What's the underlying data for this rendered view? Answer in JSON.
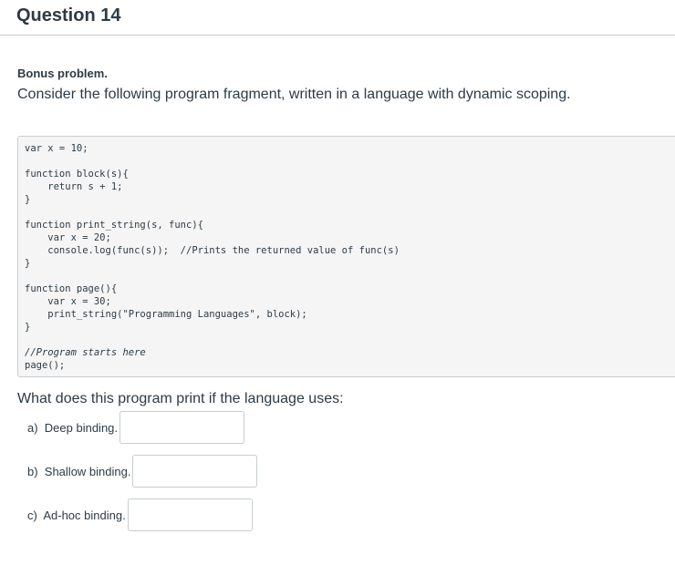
{
  "question": {
    "title": "Question 14",
    "bonus": "Bonus problem.",
    "intro": "Consider the following program fragment, written in a language with dynamic scoping.",
    "code_lines": [
      "var x = 10;",
      "",
      "function block(s){",
      "    return s + 1;",
      "}",
      "",
      "function print_string(s, func){",
      "    var x = 20;",
      "    console.log(func(s));  //Prints the returned value of func(s)",
      "}",
      "",
      "function page(){",
      "    var x = 30;",
      "    print_string(\"Programming Languages\", block);",
      "}",
      "",
      "//Program starts here",
      "page();"
    ],
    "prompt": "What does this program print if the language uses:",
    "answers": [
      {
        "label": "a)  Deep binding.",
        "value": ""
      },
      {
        "label": "b)  Shallow binding.",
        "value": ""
      },
      {
        "label": "c)  Ad-hoc binding.",
        "value": ""
      }
    ]
  }
}
